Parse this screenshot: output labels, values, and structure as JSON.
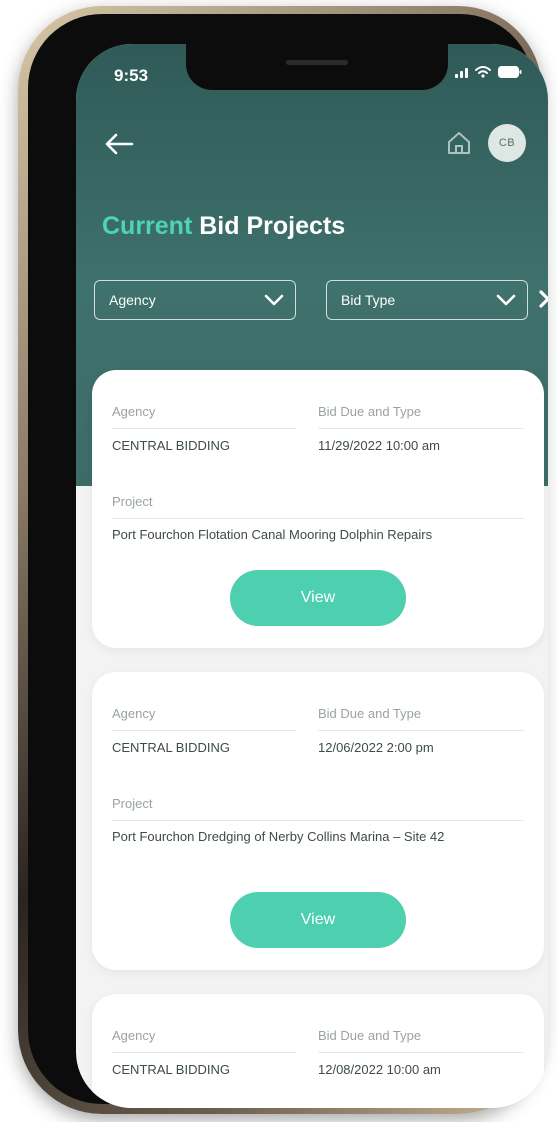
{
  "status_bar": {
    "time": "9:53"
  },
  "header": {
    "avatar_initials": "CB",
    "title_accent": "Current",
    "title_rest": "Bid Projects"
  },
  "filters": {
    "agency_label": "Agency",
    "bid_type_label": "Bid Type"
  },
  "bids": [
    {
      "agency_label": "Agency",
      "due_label": "Bid Due and Type",
      "agency": "CENTRAL BIDDING",
      "due": "11/29/2022 10:00 am",
      "project_label": "Project",
      "project": "Port Fourchon Flotation Canal Mooring Dolphin Repairs",
      "view_label": "View"
    },
    {
      "agency_label": "Agency",
      "due_label": "Bid Due and Type",
      "agency": "CENTRAL BIDDING",
      "due": "12/06/2022 2:00 pm",
      "project_label": "Project",
      "project": "Port Fourchon Dredging of Nerby Collins Marina – Site 42",
      "view_label": "View"
    },
    {
      "agency_label": "Agency",
      "due_label": "Bid Due and Type",
      "agency": "CENTRAL BIDDING",
      "due": "12/08/2022 10:00 am"
    }
  ],
  "colors": {
    "header": "#3d6c68",
    "accent": "#4fd3b5",
    "button": "#4dcfb0"
  },
  "icons": [
    "back-arrow-icon",
    "home-icon",
    "chevron-down-icon",
    "close-icon",
    "signal-icon",
    "wifi-icon",
    "battery-icon"
  ]
}
